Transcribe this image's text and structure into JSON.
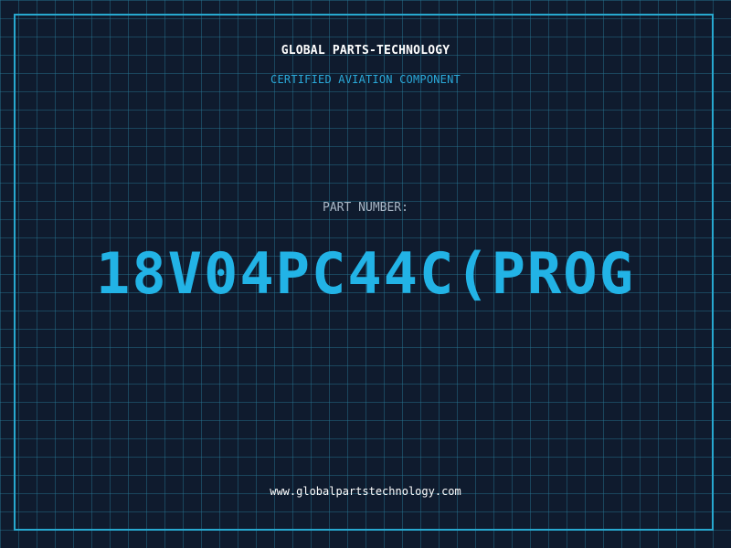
{
  "header": {
    "company": "GLOBAL PARTS-TECHNOLOGY",
    "tagline": "CERTIFIED AVIATION COMPONENT"
  },
  "part": {
    "label": "PART NUMBER:",
    "number": "18V04PC44C(PROG"
  },
  "footer": {
    "website": "www.globalpartstechnology.com"
  },
  "colors": {
    "background": "#0f1b2e",
    "grid": "#1f5a74",
    "accent": "#22b3e6",
    "frame": "#27a8cf"
  }
}
